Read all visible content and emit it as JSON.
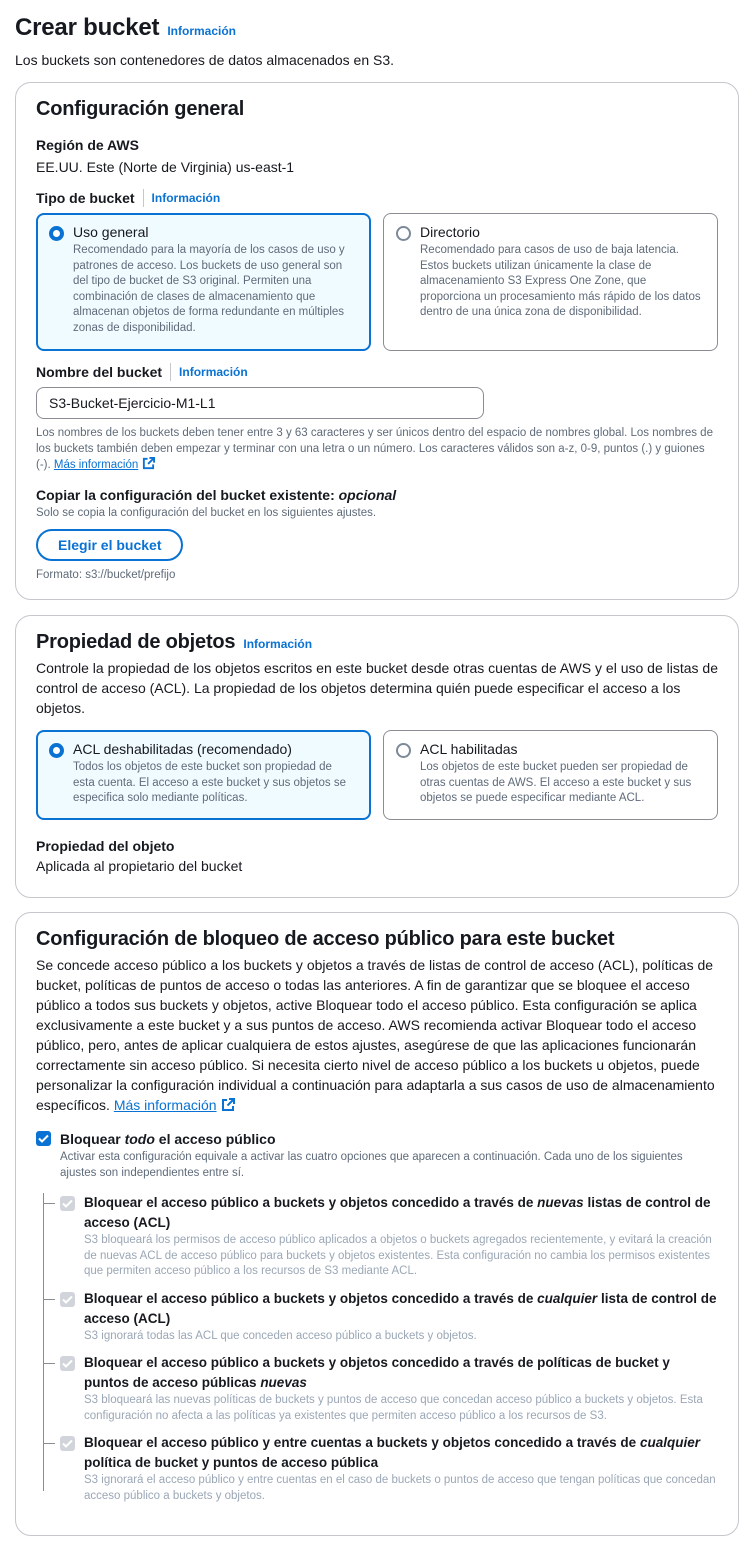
{
  "header": {
    "title": "Crear bucket",
    "info": "Información",
    "subtitle": "Los buckets son contenedores de datos almacenados en S3."
  },
  "general": {
    "title": "Configuración general",
    "region_label": "Región de AWS",
    "region_value": "EE.UU. Este (Norte de Virginia) us-east-1",
    "bucket_type_label": "Tipo de bucket",
    "info": "Información",
    "types": [
      {
        "label": "Uso general",
        "desc": "Recomendado para la mayoría de los casos de uso y patrones de acceso. Los buckets de uso general son del tipo de bucket de S3 original. Permiten una combinación de clases de almacenamiento que almacenan objetos de forma redundante en múltiples zonas de disponibilidad.",
        "selected": true
      },
      {
        "label": "Directorio",
        "desc": "Recomendado para casos de uso de baja latencia. Estos buckets utilizan únicamente la clase de almacenamiento S3 Express One Zone, que proporciona un procesamiento más rápido de los datos dentro de una única zona de disponibilidad.",
        "selected": false
      }
    ],
    "name_label": "Nombre del bucket",
    "name_value": "S3-Bucket-Ejercicio-M1-L1",
    "name_hint": "Los nombres de los buckets deben tener entre 3 y 63 caracteres y ser únicos dentro del espacio de nombres global. Los nombres de los buckets también deben empezar y terminar con una letra o un número. Los caracteres válidos son a-z, 0-9, puntos (.) y guiones (-).",
    "more_info": "Más información",
    "copy_label": "Copiar la configuración del bucket existente:",
    "copy_optional": "opcional",
    "copy_hint": "Solo se copia la configuración del bucket en los siguientes ajustes.",
    "choose_button": "Elegir el bucket",
    "format_hint": "Formato: s3://bucket/prefijo"
  },
  "ownership": {
    "title": "Propiedad de objetos",
    "info": "Información",
    "desc": "Controle la propiedad de los objetos escritos en este bucket desde otras cuentas de AWS y el uso de listas de control de acceso (ACL). La propiedad de los objetos determina quién puede especificar el acceso a los objetos.",
    "options": [
      {
        "label": "ACL deshabilitadas (recomendado)",
        "desc": "Todos los objetos de este bucket son propiedad de esta cuenta. El acceso a este bucket y sus objetos se especifica solo mediante políticas.",
        "selected": true
      },
      {
        "label": "ACL habilitadas",
        "desc": "Los objetos de este bucket pueden ser propiedad de otras cuentas de AWS. El acceso a este bucket y sus objetos se puede especificar mediante ACL.",
        "selected": false
      }
    ],
    "owner_label": "Propiedad del objeto",
    "owner_value": "Aplicada al propietario del bucket"
  },
  "block": {
    "title": "Configuración de bloqueo de acceso público para este bucket",
    "desc": "Se concede acceso público a los buckets y objetos a través de listas de control de acceso (ACL), políticas de bucket, políticas de puntos de acceso o todas las anteriores. A fin de garantizar que se bloquee el acceso público a todos sus buckets y objetos, active Bloquear todo el acceso público. Esta configuración se aplica exclusivamente a este bucket y a sus puntos de acceso. AWS recomienda activar Bloquear todo el acceso público, pero, antes de aplicar cualquiera de estos ajustes, asegúrese de que las aplicaciones funcionarán correctamente sin acceso público. Si necesita cierto nivel de acceso público a los buckets u objetos, puede personalizar la configuración individual a continuación para adaptarla a sus casos de uso de almacenamiento específicos.",
    "more_info": "Más información",
    "all": {
      "pre": "Bloquear ",
      "em": "todo",
      "post": " el acceso público",
      "desc": "Activar esta configuración equivale a activar las cuatro opciones que aparecen a continuación. Cada uno de los siguientes ajustes son independientes entre sí.",
      "checked": true
    },
    "items": [
      {
        "pre": "Bloquear el acceso público a buckets y objetos concedido a través de ",
        "em": "nuevas",
        "post": " listas de control de acceso (ACL)",
        "desc": "S3 bloqueará los permisos de acceso público aplicados a objetos o buckets agregados recientemente, y evitará la creación de nuevas ACL de acceso público para buckets y objetos existentes. Esta configuración no cambia los permisos existentes que permiten acceso público a los recursos de S3 mediante ACL."
      },
      {
        "pre": "Bloquear el acceso público a buckets y objetos concedido a través de ",
        "em": "cualquier",
        "post": " lista de control de acceso (ACL)",
        "desc": "S3 ignorará todas las ACL que conceden acceso público a buckets y objetos."
      },
      {
        "pre": "Bloquear el acceso público a buckets y objetos concedido a través de políticas de bucket y puntos de acceso públicas ",
        "em": "nuevas",
        "post": "",
        "desc": "S3 bloqueará las nuevas políticas de buckets y puntos de acceso que concedan acceso público a buckets y objetos. Esta configuración no afecta a las políticas ya existentes que permiten acceso público a los recursos de S3."
      },
      {
        "pre": "Bloquear el acceso público y entre cuentas a buckets y objetos concedido a través de ",
        "em": "cualquier",
        "post": " política de bucket y puntos de acceso pública",
        "desc": "S3 ignorará el acceso público y entre cuentas en el caso de buckets o puntos de acceso que tengan políticas que concedan acceso público a buckets y objetos."
      }
    ]
  }
}
